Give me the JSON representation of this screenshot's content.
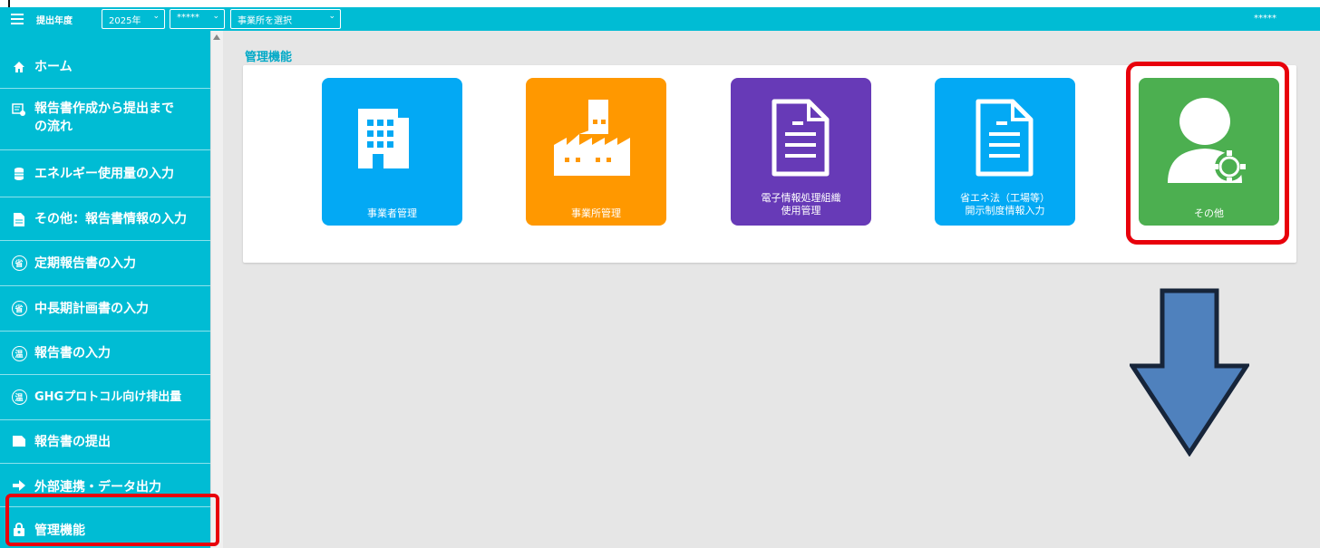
{
  "header": {
    "year_label": "提出年度",
    "year_value": "2025年",
    "company_value": "*****",
    "office_placeholder": "事業所を選択",
    "user": "*****",
    "accent_color": "#00bcd4"
  },
  "sidebar": {
    "items": [
      {
        "label": "ホーム",
        "icon": "home-icon"
      },
      {
        "label": "報告書作成から提出までの流れ",
        "line1": "報告書作成から提出まで",
        "line2": "の流れ",
        "icon": "flow-icon"
      },
      {
        "label": "エネルギー使用量の入力",
        "icon": "database-icon"
      },
      {
        "label": "その他：報告書情報の入力",
        "icon": "document-icon"
      },
      {
        "label": "定期報告書の入力",
        "icon": "circle-kanji-icon",
        "glyph": "省"
      },
      {
        "label": "中長期計画書の入力",
        "icon": "circle-kanji-icon",
        "glyph": "省"
      },
      {
        "label": "報告書の入力",
        "icon": "circle-kanji-icon",
        "glyph": "温"
      },
      {
        "label": "GHGプロトコル向け排出量",
        "icon": "circle-kanji-icon",
        "glyph": "温"
      },
      {
        "label": "報告書の提出",
        "icon": "folder-icon"
      },
      {
        "label": "外部連携・データ出力",
        "icon": "arrow-right-icon"
      },
      {
        "label": "管理機能",
        "icon": "lock-icon"
      }
    ]
  },
  "main": {
    "section_title": "管理機能",
    "tiles": [
      {
        "label_line1": "",
        "label_line2": "事業者管理",
        "icon": "building-icon",
        "color": "#03a9f4"
      },
      {
        "label_line1": "",
        "label_line2": "事業所管理",
        "icon": "factory-icon",
        "color": "#ff9800"
      },
      {
        "label_line1": "電子情報処理組織",
        "label_line2": "使用管理",
        "icon": "document-icon",
        "color": "#673ab7"
      },
      {
        "label_line1": "省エネ法（工場等）",
        "label_line2": "開示制度情報入力",
        "icon": "document-icon",
        "color": "#03a9f4"
      },
      {
        "label_line1": "",
        "label_line2": "その他",
        "icon": "user-gear-icon",
        "color": "#4caf50"
      }
    ]
  },
  "annotation": {
    "highlight_color": "#e8000b",
    "arrow_color": "#4f81bd"
  }
}
